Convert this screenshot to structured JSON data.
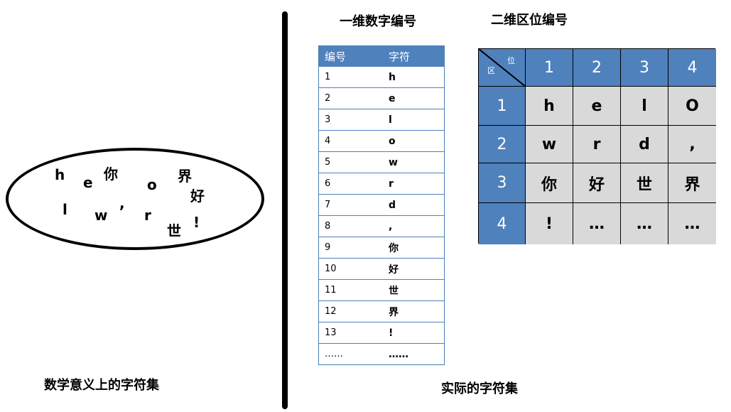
{
  "left": {
    "symbols": [
      "h",
      "e",
      "你",
      "o",
      "界",
      "好",
      "l",
      "w",
      ",",
      "r",
      "!",
      "世"
    ],
    "caption": "数学意义上的字符集"
  },
  "one_d": {
    "title": "一维数字编号",
    "headers": [
      "编号",
      "字符"
    ],
    "rows": [
      [
        "1",
        "h"
      ],
      [
        "2",
        "e"
      ],
      [
        "3",
        "l"
      ],
      [
        "4",
        "o"
      ],
      [
        "5",
        "w"
      ],
      [
        "6",
        "r"
      ],
      [
        "7",
        "d"
      ],
      [
        "8",
        ","
      ],
      [
        "9",
        "你"
      ],
      [
        "10",
        "好"
      ],
      [
        "11",
        "世"
      ],
      [
        "12",
        "界"
      ],
      [
        "13",
        "!"
      ],
      [
        "……",
        "……"
      ]
    ]
  },
  "two_d": {
    "title": "二维区位编号",
    "corner_top": "位",
    "corner_bottom": "区",
    "col_headers": [
      "1",
      "2",
      "3",
      "4"
    ],
    "row_headers": [
      "1",
      "2",
      "3",
      "4"
    ],
    "cells": [
      [
        "h",
        "e",
        "l",
        "O"
      ],
      [
        "w",
        "r",
        "d",
        ","
      ],
      [
        "你",
        "好",
        "世",
        "界"
      ],
      [
        "!",
        "…",
        "…",
        "…"
      ]
    ]
  },
  "bottom_caption": "实际的字符集",
  "colors": {
    "header_blue": "#4f81bd",
    "cell_gray": "#d9d9d9"
  }
}
